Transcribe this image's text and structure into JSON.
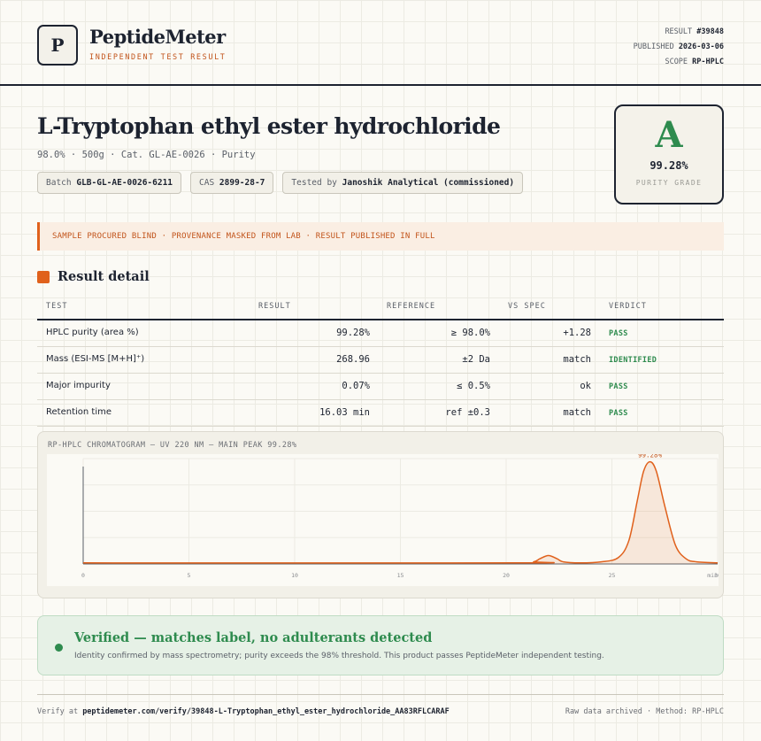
{
  "header": {
    "logo_letter": "P",
    "brand": "PeptideMeter",
    "brand_sub": "INDEPENDENT TEST RESULT",
    "result_label": "RESULT",
    "result_value": "#39848",
    "published_label": "PUBLISHED",
    "published_value": "2026-03-06",
    "scope_label": "SCOPE",
    "scope_value": "RP-HPLC"
  },
  "product": {
    "title": "L-Tryptophan ethyl ester hydrochloride",
    "subtitle": "98.0% · 500g · Cat. GL-AE-0026 · Purity",
    "tags": [
      {
        "label": "Batch",
        "value": "GLB-GL-AE-0026-6211"
      },
      {
        "label": "CAS",
        "value": "2899-28-7"
      },
      {
        "label": "Tested by",
        "value": "Janoshik Analytical (commissioned)"
      }
    ]
  },
  "grade": {
    "letter": "A",
    "percent": "99.28%",
    "label": "PURITY GRADE"
  },
  "banner": "SAMPLE PROCURED BLIND · PROVENANCE MASKED FROM LAB · RESULT PUBLISHED IN FULL",
  "section_title": "Result detail",
  "table": {
    "headers": [
      "TEST",
      "RESULT",
      "REFERENCE",
      "VS SPEC",
      "VERDICT"
    ],
    "rows": [
      {
        "test": "HPLC purity (area %)",
        "result": "99.28%",
        "reference": "≥ 98.0%",
        "vs_spec": "+1.28",
        "verdict": "PASS"
      },
      {
        "test": "Mass (ESI-MS [M+H]⁺)",
        "result": "268.96",
        "reference": "±2 Da",
        "vs_spec": "match",
        "verdict": "IDENTIFIED"
      },
      {
        "test": "Major impurity",
        "result": "0.07%",
        "reference": "≤ 0.5%",
        "vs_spec": "ok",
        "verdict": "PASS"
      },
      {
        "test": "Retention time",
        "result": "16.03 min",
        "reference": "ref ±0.3",
        "vs_spec": "match",
        "verdict": "PASS"
      }
    ]
  },
  "chart_data": {
    "type": "line",
    "title": "RP-HPLC CHROMATOGRAM — UV 220 NM — MAIN PEAK 99.28%",
    "xlabel": "",
    "ylabel": "",
    "xlim": [
      0,
      30
    ],
    "ylim": [
      0,
      100
    ],
    "ticks": [
      0,
      5,
      10,
      15,
      20,
      25,
      30
    ],
    "tick_labels": [
      "0",
      "5",
      "10",
      "15",
      "20",
      "25",
      "30"
    ],
    "x_end_label": "min",
    "grid": true,
    "series": [
      {
        "color": "#e0611c",
        "x": [
          0,
          20.5,
          21.3,
          21.6,
          22.0,
          22.4,
          22.7,
          23.5,
          24.5,
          25.3,
          25.8,
          26.2,
          26.5,
          26.8,
          27.1,
          27.5,
          28.0,
          28.5,
          29.0,
          30
        ],
        "y": [
          1,
          1,
          2,
          5,
          8,
          5,
          2,
          1,
          2,
          6,
          22,
          60,
          88,
          97,
          88,
          55,
          18,
          5,
          2,
          1
        ]
      }
    ],
    "annotations": [
      {
        "x": 26.8,
        "y": 97,
        "text": "99.28%"
      }
    ]
  },
  "verified": {
    "title": "Verified — matches label, no adulterants detected",
    "text": "Identity confirmed by mass spectrometry; purity exceeds the 98% threshold. This product passes PeptideMeter independent testing."
  },
  "footer": {
    "verify_prefix": "Verify at",
    "verify_url": "peptidemeter.com/verify/39848-L-Tryptophan_ethyl_ester_hydrochloride_AA83RFLCARAF",
    "right": "Raw data archived · Method: RP-HPLC"
  },
  "colors": {
    "accent": "#e0611c",
    "pass": "#2e8b4e",
    "ink": "#1d2330"
  }
}
